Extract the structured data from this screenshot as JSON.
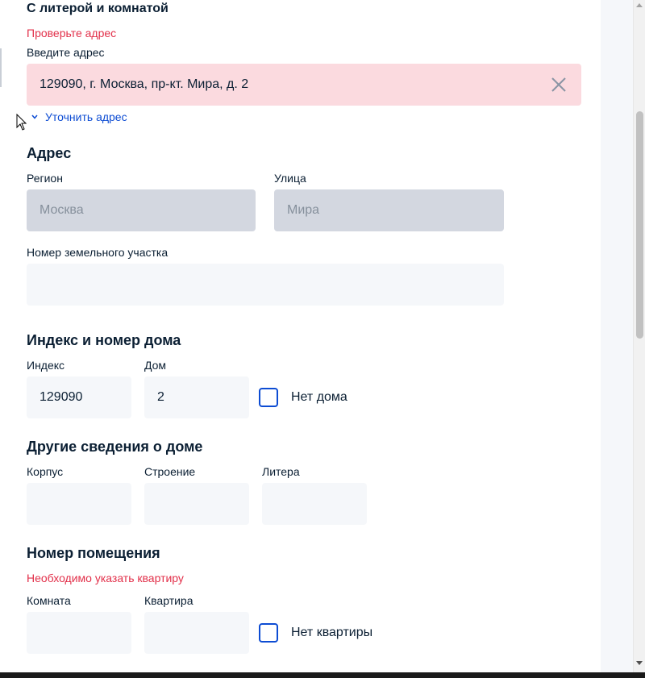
{
  "top_section": {
    "title": "С литерой и комнатой",
    "error": "Проверьте адрес",
    "address_label": "Введите адрес",
    "address_value": "129090, г. Москва, пр-кт. Мира, д. 2",
    "clarify_link": "Уточнить адрес"
  },
  "address_section": {
    "title": "Адрес",
    "region_label": "Регион",
    "region_value": "Москва",
    "street_label": "Улица",
    "street_value": "Мира",
    "plot_label": "Номер земельного участка",
    "plot_value": ""
  },
  "index_section": {
    "title": "Индекс и номер дома",
    "index_label": "Индекс",
    "index_value": "129090",
    "house_label": "Дом",
    "house_value": "2",
    "no_house_label": "Нет дома"
  },
  "other_section": {
    "title": "Другие сведения о доме",
    "korpus_label": "Корпус",
    "korpus_value": "",
    "stroenie_label": "Строение",
    "stroenie_value": "",
    "litera_label": "Литера",
    "litera_value": ""
  },
  "room_section": {
    "title": "Номер помещения",
    "error": "Необходимо указать квартиру",
    "room_label": "Комната",
    "room_value": "",
    "apartment_label": "Квартира",
    "apartment_value": "",
    "no_apartment_label": "Нет квартиры"
  },
  "colors": {
    "text": "#0b1f33",
    "error": "#e2304a",
    "link": "#0d4cd3",
    "input_bg": "#f5f7fa",
    "input_error_bg": "#fbdadf",
    "input_disabled_bg": "#d3d7e0"
  }
}
